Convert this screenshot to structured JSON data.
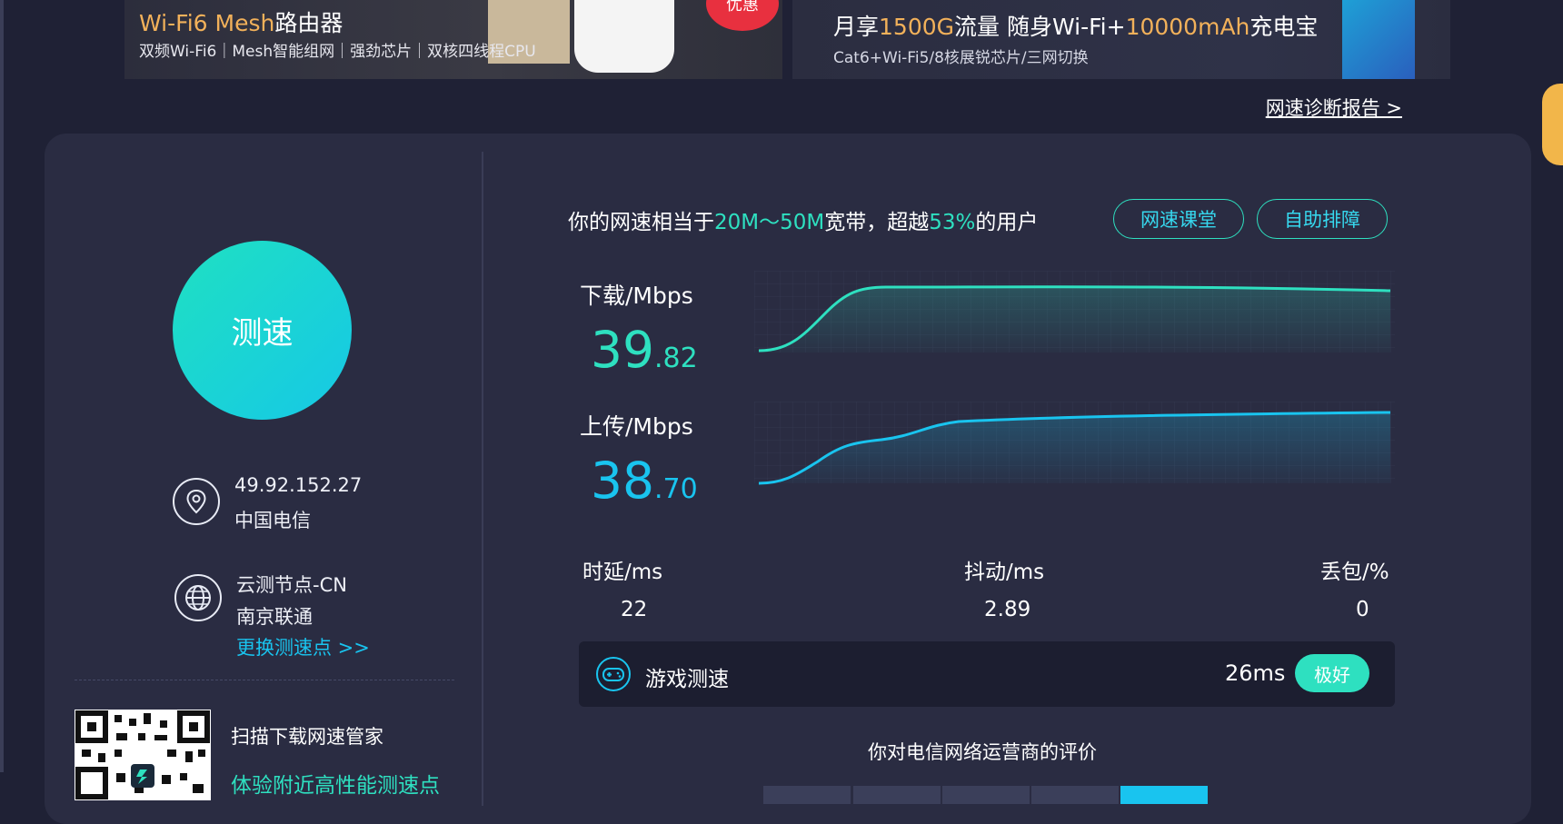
{
  "banners": [
    {
      "title_colored": "Wi-Fi6 Mesh",
      "title_white": "路由器",
      "subtitle": "双频Wi-Fi6｜Mesh智能组网｜强劲芯片｜双核四线程CPU",
      "badge": "优惠"
    },
    {
      "title_parts": [
        "月享",
        "1500G",
        "流量  随身Wi-Fi+",
        "10000mAh",
        "充电宝"
      ],
      "subtitle": "Cat6+Wi-Fi5/8核展锐芯片/三网切换"
    }
  ],
  "report_link": "网速诊断报告 >",
  "speed_button": "测速",
  "client": {
    "ip": "49.92.152.27",
    "isp": "中国电信"
  },
  "node": {
    "name": "云测节点-CN",
    "isp": "南京联通",
    "switch_label": "更换测速点 >>"
  },
  "qr": {
    "line1": "扫描下载网速管家",
    "line2": "体验附近高性能测速点"
  },
  "summary": {
    "prefix": "你的网速相当于",
    "bandwidth": "20M～50M",
    "mid": "宽带，超越",
    "percent": "53%",
    "suffix": "的用户"
  },
  "buttons": {
    "classroom": "网速课堂",
    "troubleshoot": "自助排障"
  },
  "download": {
    "label": "下载/Mbps",
    "int": "39",
    "dec": ".82"
  },
  "upload": {
    "label": "上传/Mbps",
    "int": "38",
    "dec": ".70"
  },
  "stats": [
    {
      "label": "时延/ms",
      "value": "22"
    },
    {
      "label": "抖动/ms",
      "value": "2.89"
    },
    {
      "label": "丢包/%",
      "value": "0"
    }
  ],
  "game": {
    "label": "游戏测速",
    "latency": "26ms",
    "rating": "极好"
  },
  "rating_title": "你对电信网络运营商的评价",
  "colors": {
    "accent_green": "#2ee0c0",
    "accent_blue": "#19c4ef",
    "panel": "#2a2c42",
    "background": "#1f2135"
  },
  "icons": [
    "location-pin-icon",
    "globe-icon",
    "gamepad-icon",
    "qr-code-icon"
  ]
}
